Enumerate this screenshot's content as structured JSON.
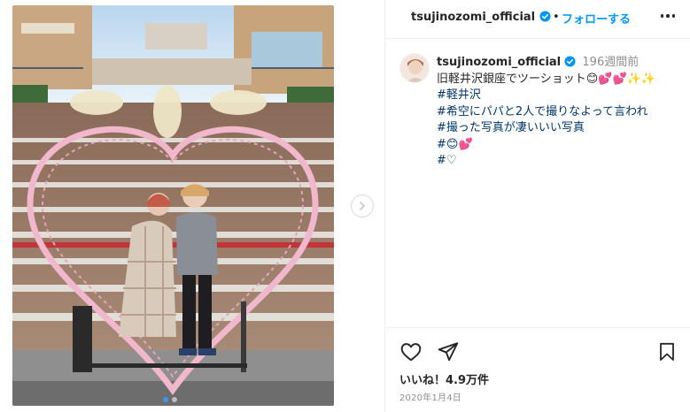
{
  "post": {
    "username": "tsujinozomi_official",
    "follow_separator": "•",
    "follow_label": "フォローする",
    "more_icon": "more-horizontal-icon",
    "verified_icon": "verified-badge-icon",
    "brand_blue": "#0095f6"
  },
  "caption": {
    "username": "tsujinozomi_official",
    "time_ago": "196週間前",
    "line1": "旧軽井沢銀座でツーショット😊💕💕✨✨",
    "hashtags": [
      "#軽井沢",
      "#希空にパパと2人で撮りなよって言われ",
      "#撮った写真が凄いいい写真",
      "#😊💕",
      "#♡"
    ]
  },
  "actions": {
    "like_icon": "heart-outline-icon",
    "share_icon": "paper-plane-icon",
    "save_icon": "bookmark-outline-icon"
  },
  "likes": {
    "text": "いいね！4.9万件"
  },
  "date": {
    "text": "2020年1月4日"
  },
  "carousel": {
    "next_icon": "chevron-right-icon",
    "dots": 2,
    "active_index": 0
  }
}
